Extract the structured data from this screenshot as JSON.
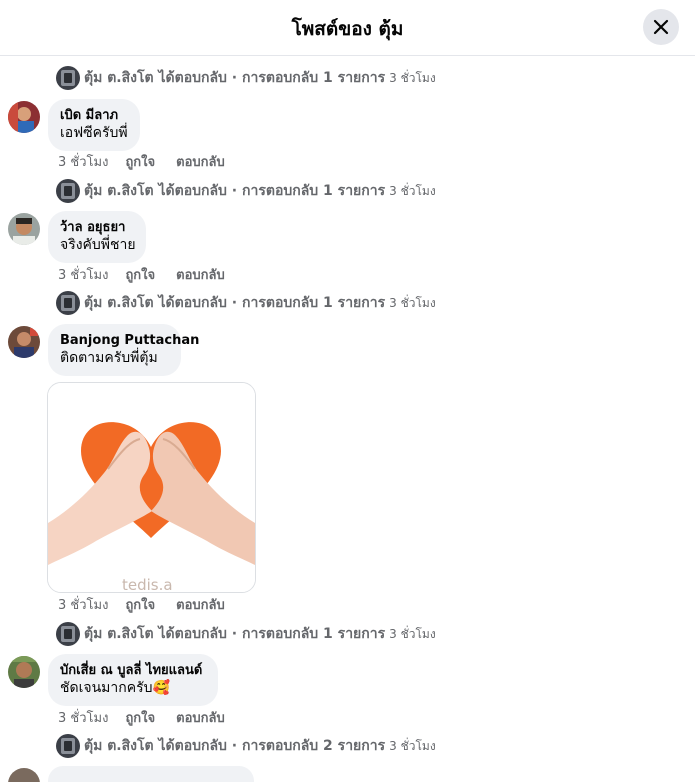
{
  "header": {
    "title": "โพสต์ของ ตุ้ม"
  },
  "reply_summaries": [
    {
      "text": "ตุ้ม ต.สิงโต ได้ตอบกลับ · การตอบกลับ 1 รายการ",
      "time": "3 ชั่วโมง"
    },
    {
      "text": "ตุ้ม ต.สิงโต ได้ตอบกลับ · การตอบกลับ 1 รายการ",
      "time": "3 ชั่วโมง"
    },
    {
      "text": "ตุ้ม ต.สิงโต ได้ตอบกลับ · การตอบกลับ 1 รายการ",
      "time": "3 ชั่วโมง"
    },
    {
      "text": "ตุ้ม ต.สิงโต ได้ตอบกลับ · การตอบกลับ 1 รายการ",
      "time": "3 ชั่วโมง"
    },
    {
      "text": "ตุ้ม ต.สิงโต ได้ตอบกลับ · การตอบกลับ 2 รายการ",
      "time": "3 ชั่วโมง"
    }
  ],
  "comments": [
    {
      "name": "เบิด มีลาภ",
      "text": "เอฟซีครับพี่",
      "time": "3 ชั่วโมง",
      "like": "ถูกใจ",
      "reply": "ตอบกลับ"
    },
    {
      "name": "ว้าล อยุธยา",
      "text": "จริงคับพี่ชาย",
      "time": "3 ชั่วโมง",
      "like": "ถูกใจ",
      "reply": "ตอบกลับ"
    },
    {
      "name": "Banjong Puttachan",
      "text": "ติดตามครับพี่ตุ้ม",
      "time": "3 ชั่วโมง",
      "like": "ถูกใจ",
      "reply": "ตอบกลับ"
    },
    {
      "name": "บักเสี่ย ณ บูลลี่ ไทยแลนด์",
      "text": "ชัดเจนมากครับ🥰",
      "time": "3 ชั่วโมง",
      "like": "ถูกใจ",
      "reply": "ตอบกลับ"
    }
  ],
  "icons": {
    "close": "close-icon",
    "heart_sticker": "heart-hands-sticker"
  },
  "colors": {
    "bubble": "#f0f2f5",
    "secondary_text": "#65676b",
    "heart": "#f26a25"
  }
}
